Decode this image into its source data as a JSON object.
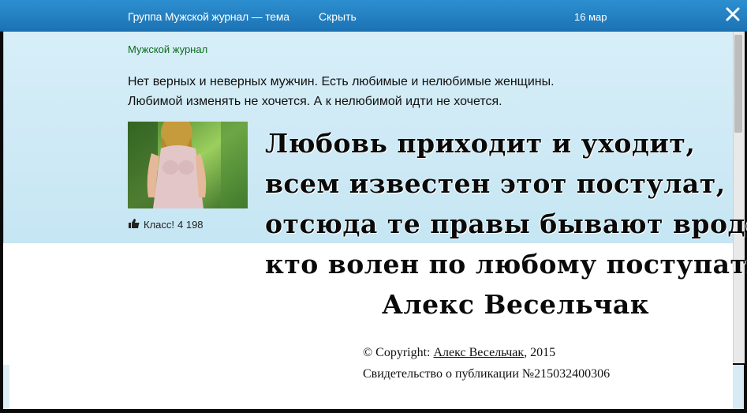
{
  "header": {
    "title": "Группа Мужской журнал — тема",
    "hide_label": "Скрыть",
    "date": "16 мар"
  },
  "post": {
    "group_name": "Мужской журнал",
    "text_line1": "Нет верных и неверных мужчин. Есть любимые и нелюбимые женщины.",
    "text_line2": "Любимой изменять не хочется. А к нелюбимой идти не хочется.",
    "like_label": "Класс!",
    "like_count": "4 198"
  },
  "poem": {
    "lines": [
      "Любовь приходит и уходит,",
      "всем известен этот постулат,",
      "отсюда те правы бывают вроде,",
      "кто волен по любому поступать."
    ],
    "author": "Алекс Весельчак"
  },
  "copyright": {
    "prefix": "© Copyright: ",
    "author_link": "Алекс Весельчак",
    "year": ", 2015",
    "certificate": "Свидетельство о публикации №215032400306"
  },
  "colors": {
    "topbar": "#1b72b3",
    "panel": "#cde9f5",
    "group_link": "#0c6a1d"
  },
  "icons": {
    "close": "close-icon",
    "like": "thumbs-up-icon"
  }
}
